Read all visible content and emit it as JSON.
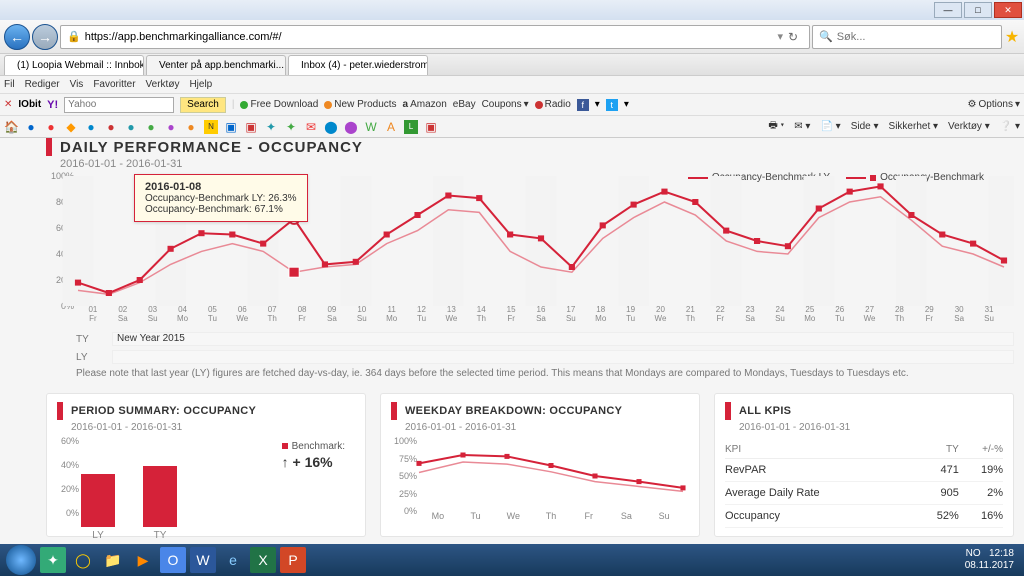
{
  "browser": {
    "url": "https://app.benchmarkingalliance.com/#/",
    "search_placeholder": "Søk...",
    "tabs": [
      {
        "label": "(1) Loopia Webmail :: Innboks"
      },
      {
        "label": "Venter på app.benchmarki..."
      },
      {
        "label": "Inbox (4) - peter.wiederstrom..."
      }
    ],
    "menu": [
      "Fil",
      "Rediger",
      "Vis",
      "Favoritter",
      "Verktøy",
      "Hjelp"
    ],
    "toolbar": {
      "brand": "IObit",
      "search_provider": "Yahoo",
      "search_btn": "Search",
      "links": [
        "Free Download",
        "New Products",
        "Amazon",
        "eBay",
        "Coupons",
        "Radio"
      ],
      "options": "Options",
      "right_links": [
        "Side",
        "Sikkerhet",
        "Verktøy"
      ]
    }
  },
  "main": {
    "title": "DAILY PERFORMANCE - OCCUPANCY",
    "range": "2016-01-01 - 2016-01-31",
    "legend": {
      "ly": "Occupancy-Benchmark LY",
      "ty": "Occupancy-Benchmark"
    },
    "tooltip": {
      "date": "2016-01-08",
      "l1": "Occupancy-Benchmark LY: 26.3%",
      "l2": "Occupancy-Benchmark: 67.1%"
    },
    "tyly": {
      "ty_label": "TY",
      "ty_val": "New Year 2015",
      "ly_label": "LY"
    },
    "note": "Please note that last year (LY) figures are fetched day-vs-day, ie. 364 days before the selected time period. This means that Mondays are compared to Mondays, Tuesdays to Tuesdays etc."
  },
  "summary": {
    "title": "PERIOD SUMMARY: OCCUPANCY",
    "range": "2016-01-01 - 2016-01-31",
    "bench_label": "Benchmark:",
    "bench_val": "+ 16%"
  },
  "weekday": {
    "title": "WEEKDAY BREAKDOWN: OCCUPANCY",
    "range": "2016-01-01 - 2016-01-31"
  },
  "kpis": {
    "title": "ALL KPIS",
    "range": "2016-01-01 - 2016-01-31",
    "headers": {
      "kpi": "KPI",
      "ty": "TY",
      "pct": "+/-%"
    },
    "rows": [
      {
        "name": "RevPAR",
        "ty": "471",
        "pct": "19%"
      },
      {
        "name": "Average Daily Rate",
        "ty": "905",
        "pct": "2%"
      },
      {
        "name": "Occupancy",
        "ty": "52%",
        "pct": "16%"
      }
    ]
  },
  "clock": {
    "time": "12:18",
    "date": "08.11.2017",
    "lang": "NO"
  },
  "chart_data": {
    "main": {
      "type": "line",
      "ylim": [
        0,
        100
      ],
      "ylabel_pct": [
        "0%",
        "20%",
        "40%",
        "60%",
        "80%",
        "100%"
      ],
      "x_days": [
        "01",
        "02",
        "03",
        "04",
        "05",
        "06",
        "07",
        "08",
        "09",
        "10",
        "11",
        "12",
        "13",
        "14",
        "15",
        "16",
        "17",
        "18",
        "19",
        "20",
        "21",
        "22",
        "23",
        "24",
        "25",
        "26",
        "27",
        "28",
        "29",
        "30",
        "31"
      ],
      "x_dow": [
        "Fr",
        "Sa",
        "Su",
        "Mo",
        "Tu",
        "We",
        "Th",
        "Fr",
        "Sa",
        "Su",
        "Mo",
        "Tu",
        "We",
        "Th",
        "Fr",
        "Sa",
        "Su",
        "Mo",
        "Tu",
        "We",
        "Th",
        "Fr",
        "Sa",
        "Su",
        "Mo",
        "Tu",
        "We",
        "Th",
        "Fr",
        "Sa",
        "Su"
      ],
      "series": [
        {
          "name": "Occupancy-Benchmark LY",
          "values": [
            12,
            9,
            18,
            32,
            42,
            48,
            42,
            26,
            30,
            32,
            48,
            58,
            74,
            72,
            42,
            30,
            26,
            52,
            68,
            80,
            70,
            50,
            42,
            40,
            68,
            80,
            84,
            66,
            46,
            40,
            30
          ]
        },
        {
          "name": "Occupancy-Benchmark",
          "values": [
            18,
            10,
            20,
            44,
            56,
            55,
            48,
            67,
            32,
            34,
            55,
            70,
            85,
            83,
            55,
            52,
            30,
            62,
            78,
            88,
            80,
            58,
            50,
            46,
            75,
            88,
            92,
            70,
            55,
            48,
            35
          ]
        }
      ],
      "highlight_index": 8
    },
    "summary_bars": {
      "type": "bar",
      "ylim": [
        0,
        60
      ],
      "ylabels": [
        "0%",
        "20%",
        "40%",
        "60%"
      ],
      "categories": [
        "LY",
        "TY"
      ],
      "values": [
        44,
        51
      ]
    },
    "weekday_lines": {
      "type": "line",
      "ylim": [
        0,
        100
      ],
      "ylabels": [
        "0%",
        "25%",
        "50%",
        "75%",
        "100%"
      ],
      "categories": [
        "Mo",
        "Tu",
        "We",
        "Th",
        "Fr",
        "Sa",
        "Su"
      ],
      "series": [
        {
          "name": "LY",
          "values": [
            55,
            70,
            67,
            56,
            42,
            35,
            28
          ]
        },
        {
          "name": "TY",
          "values": [
            68,
            80,
            78,
            65,
            50,
            42,
            33
          ]
        }
      ]
    }
  }
}
